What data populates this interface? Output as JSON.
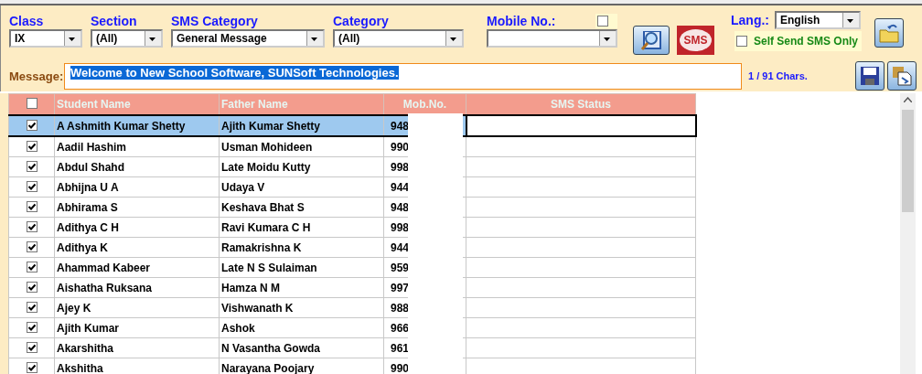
{
  "filters": [
    {
      "label": "Class",
      "value": "IX"
    },
    {
      "label": "Section",
      "value": "(All)"
    },
    {
      "label": "SMS Category",
      "value": "General Message"
    },
    {
      "label": "Category",
      "value": "(All)"
    }
  ],
  "sms_button": "SMS",
  "mobile_no": {
    "label": "Mobile No.:",
    "checked": false
  },
  "language": {
    "label": "Lang.:",
    "value": "English"
  },
  "self_send": {
    "label": "Self Send SMS Only",
    "checked": false
  },
  "message": {
    "label": "Message:",
    "value": "Welcome to New School Software, SUNSoft Technologies.",
    "selected": true
  },
  "char_count": "1 / 91 Chars.",
  "table": {
    "header_checked": false,
    "columns": [
      "Student Name",
      "Father Name",
      "Mob.No.",
      "SMS Status"
    ],
    "rows": [
      {
        "checked": true,
        "selected": true,
        "student": "A Ashmith Kumar Shetty",
        "father": "Ajith Kumar Shetty",
        "mob": "948"
      },
      {
        "checked": true,
        "selected": false,
        "student": "Aadil Hashim",
        "father": "Usman Mohideen",
        "mob": "990"
      },
      {
        "checked": true,
        "selected": false,
        "student": "Abdul Shahd",
        "father": "Late Moidu Kutty",
        "mob": "998"
      },
      {
        "checked": true,
        "selected": false,
        "student": "Abhijna U A",
        "father": "Udaya V",
        "mob": "944"
      },
      {
        "checked": true,
        "selected": false,
        "student": "Abhirama S",
        "father": "Keshava Bhat S",
        "mob": "948"
      },
      {
        "checked": true,
        "selected": false,
        "student": "Adithya C H",
        "father": "Ravi Kumara C H",
        "mob": "998"
      },
      {
        "checked": true,
        "selected": false,
        "student": "Adithya K",
        "father": "Ramakrishna K",
        "mob": "944"
      },
      {
        "checked": true,
        "selected": false,
        "student": "Ahammad Kabeer",
        "father": "Late N S Sulaiman",
        "mob": "959"
      },
      {
        "checked": true,
        "selected": false,
        "student": "Aishatha Ruksana",
        "father": "Hamza N M",
        "mob": "997"
      },
      {
        "checked": true,
        "selected": false,
        "student": "Ajey K",
        "father": "Vishwanath K",
        "mob": "988"
      },
      {
        "checked": true,
        "selected": false,
        "student": "Ajith Kumar",
        "father": "Ashok",
        "mob": "966"
      },
      {
        "checked": true,
        "selected": false,
        "student": "Akarshitha",
        "father": "N Vasantha Gowda",
        "mob": "961"
      },
      {
        "checked": true,
        "selected": false,
        "student": "Akshitha",
        "father": "Narayana Poojary",
        "mob": "990"
      }
    ]
  }
}
